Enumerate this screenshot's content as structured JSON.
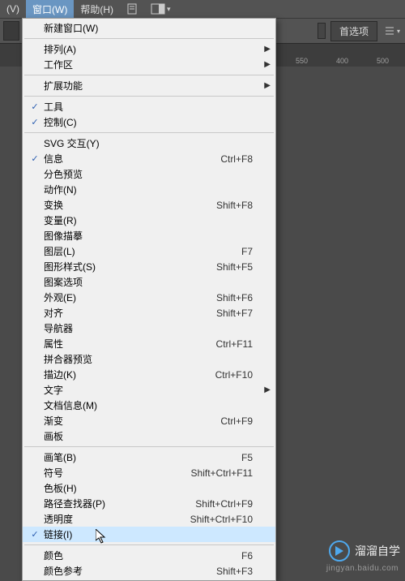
{
  "menubar": {
    "view": "(V)",
    "window": "窗口(W)",
    "help": "帮助(H)"
  },
  "toolbar": {
    "pref_label": "首选项"
  },
  "ruler": {
    "m550": "550",
    "m400": "400",
    "m500": "500"
  },
  "menu": {
    "new_window": "新建窗口(W)",
    "arrange": "排列(A)",
    "workspace": "工作区",
    "extensions": "扩展功能",
    "tools": "工具",
    "control": "控制(C)",
    "svg": "SVG 交互(Y)",
    "info": {
      "label": "信息",
      "shortcut": "Ctrl+F8"
    },
    "separations": "分色预览",
    "actions": "动作(N)",
    "transform": {
      "label": "变换",
      "shortcut": "Shift+F8"
    },
    "variables": "变量(R)",
    "image_trace": "图像描摹",
    "layers": {
      "label": "图层(L)",
      "shortcut": "F7"
    },
    "graphic_styles": {
      "label": "图形样式(S)",
      "shortcut": "Shift+F5"
    },
    "pattern_options": "图案选项",
    "appearance": {
      "label": "外观(E)",
      "shortcut": "Shift+F6"
    },
    "align": {
      "label": "对齐",
      "shortcut": "Shift+F7"
    },
    "navigator": "导航器",
    "attributes": {
      "label": "属性",
      "shortcut": "Ctrl+F11"
    },
    "flattener": "拼合器预览",
    "stroke": {
      "label": "描边(K)",
      "shortcut": "Ctrl+F10"
    },
    "type": "文字",
    "doc_info": "文档信息(M)",
    "gradient": {
      "label": "渐变",
      "shortcut": "Ctrl+F9"
    },
    "artboards": "画板",
    "brushes": {
      "label": "画笔(B)",
      "shortcut": "F5"
    },
    "symbols": {
      "label": "符号",
      "shortcut": "Shift+Ctrl+F11"
    },
    "swatches": "色板(H)",
    "pathfinder": {
      "label": "路径查找器(P)",
      "shortcut": "Shift+Ctrl+F9"
    },
    "transparency": {
      "label": "透明度",
      "shortcut": "Shift+Ctrl+F10"
    },
    "links": "链接(I)",
    "color": {
      "label": "颜色",
      "shortcut": "F6"
    },
    "color_guide": {
      "label": "颜色参考",
      "shortcut": "Shift+F3"
    }
  },
  "watermark": {
    "text": "溜溜自学",
    "sub": "jingyan.baidu.com"
  }
}
